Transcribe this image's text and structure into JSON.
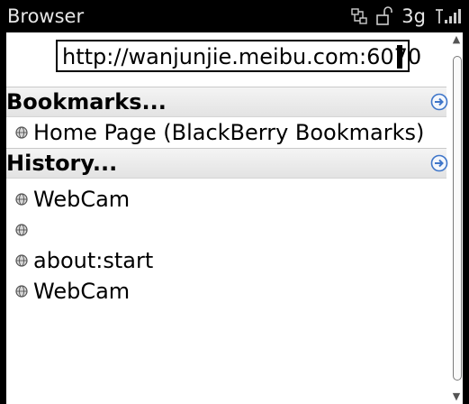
{
  "statusbar": {
    "title": "Browser",
    "network": "3g"
  },
  "address": {
    "value": "http://wanjunjie.meibu.com:6070"
  },
  "bookmarks": {
    "heading": "Bookmarks...",
    "items": [
      {
        "label": "Home Page (BlackBerry Bookmarks)"
      }
    ]
  },
  "history": {
    "heading": "History...",
    "items": [
      {
        "label": "WebCam"
      },
      {
        "label": ""
      },
      {
        "label": "about:start"
      },
      {
        "label": "WebCam"
      }
    ]
  },
  "icons": {
    "globe": "globe-icon",
    "go": "go-arrow-icon",
    "signal": "signal-icon",
    "lock": "lock-icon",
    "transfer": "data-transfer-icon"
  },
  "colors": {
    "accent": "#3f76c9",
    "statusbar": "#000000",
    "highlight": "#e3e3e3"
  }
}
